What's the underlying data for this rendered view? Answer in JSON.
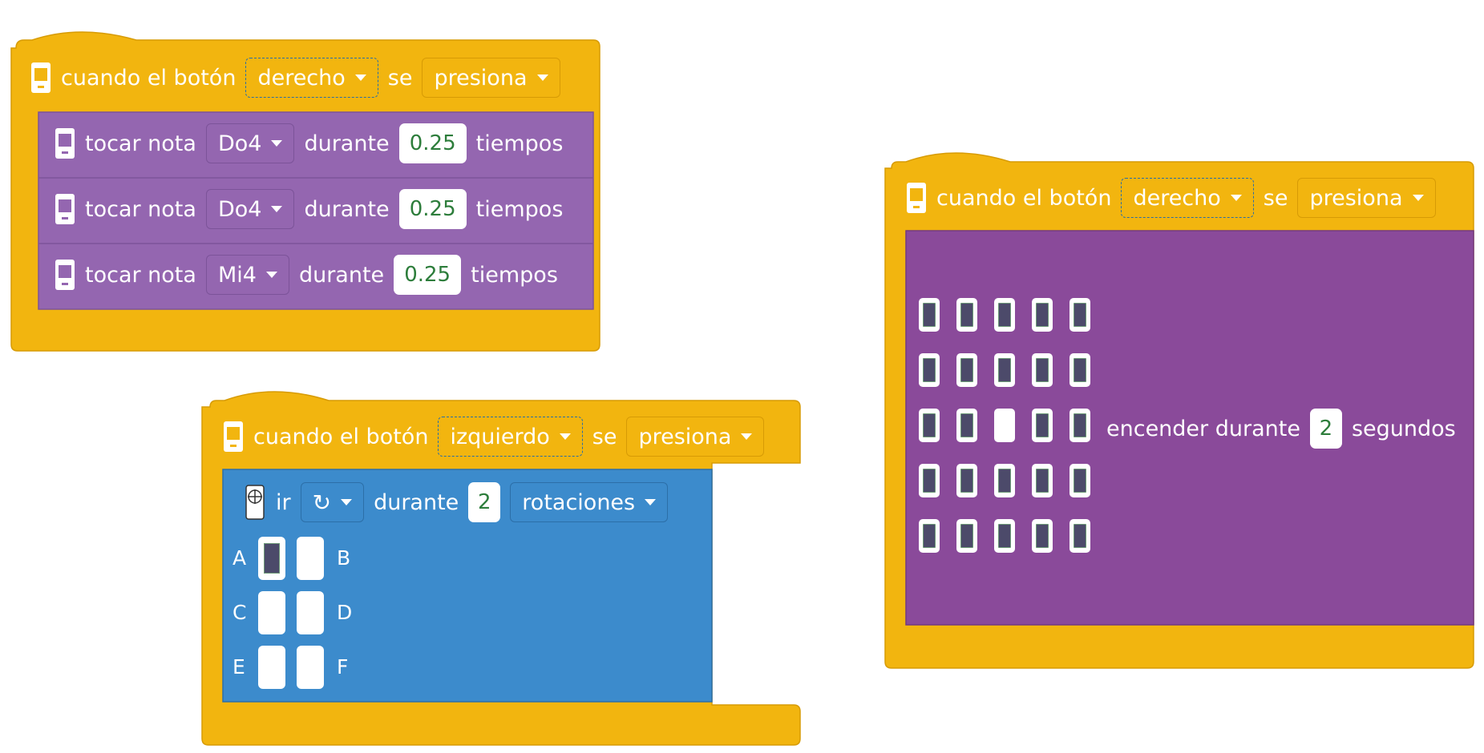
{
  "colors": {
    "event": "#f2b50f",
    "sound": "#9466b0",
    "motor": "#3c8bcc",
    "display": "#8a4a9a",
    "number_text": "#2d7d3b"
  },
  "block1": {
    "prefix": "cuando el botón",
    "button": "derecho",
    "middle": "se",
    "action": "presiona",
    "notes": [
      {
        "label": "tocar nota",
        "note": "Do4",
        "during": "durante",
        "beats": "0.25",
        "unit": "tiempos"
      },
      {
        "label": "tocar nota",
        "note": "Do4",
        "during": "durante",
        "beats": "0.25",
        "unit": "tiempos"
      },
      {
        "label": "tocar nota",
        "note": "Mi4",
        "during": "durante",
        "beats": "0.25",
        "unit": "tiempos"
      }
    ]
  },
  "block2": {
    "prefix": "cuando el botón",
    "button": "izquierdo",
    "middle": "se",
    "action": "presiona",
    "motor": {
      "go": "ir",
      "direction_icon": "rotate-clockwise-icon",
      "direction": "↻",
      "during": "durante",
      "amount": "2",
      "unit": "rotaciones",
      "ports": [
        {
          "left": "A",
          "right": "B",
          "left_on": false,
          "right_on": true
        },
        {
          "left": "C",
          "right": "D",
          "left_on": true,
          "right_on": true
        },
        {
          "left": "E",
          "right": "F",
          "left_on": true,
          "right_on": true
        }
      ]
    }
  },
  "block3": {
    "prefix": "cuando el botón",
    "button": "derecho",
    "middle": "se",
    "action": "presiona",
    "display": {
      "label": "encender durante",
      "seconds": "2",
      "unit": "segundos",
      "grid": [
        [
          0,
          0,
          0,
          0,
          0
        ],
        [
          0,
          0,
          0,
          0,
          0
        ],
        [
          0,
          0,
          1,
          0,
          0
        ],
        [
          0,
          0,
          0,
          0,
          0
        ],
        [
          0,
          0,
          0,
          0,
          0
        ]
      ]
    }
  }
}
